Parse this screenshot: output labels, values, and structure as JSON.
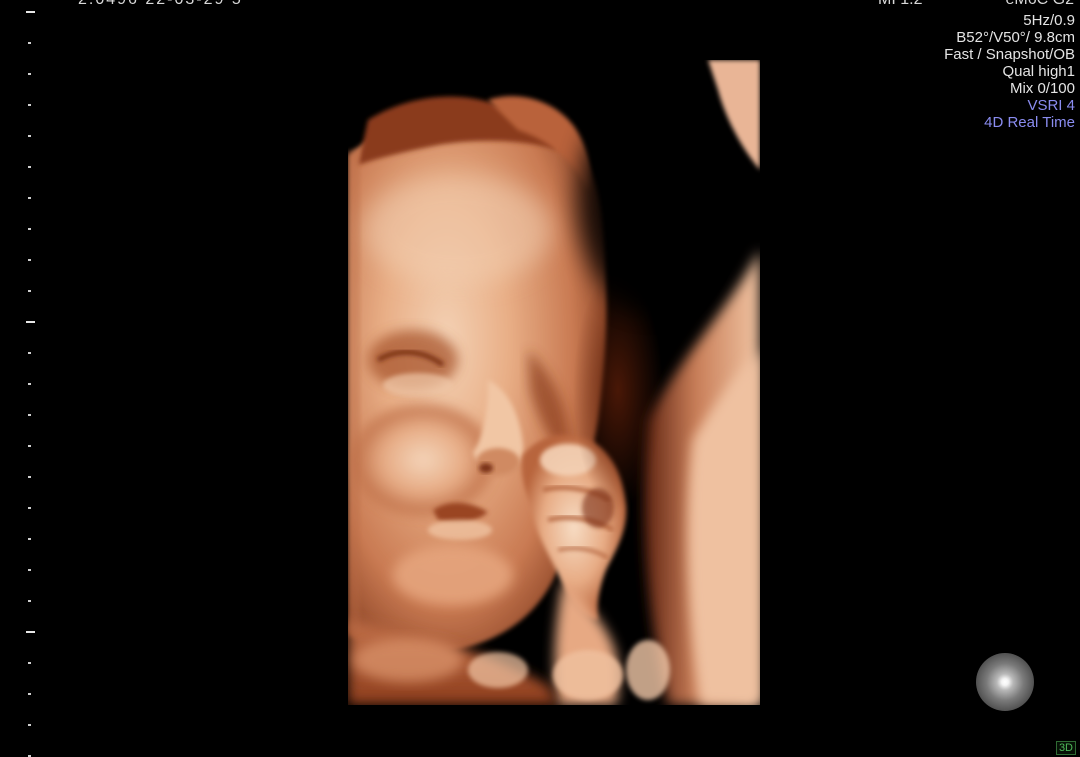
{
  "status_bar": {
    "datetime": "2:0496 22-03-29 5",
    "mi": "MI  1.2",
    "probe": "eM6C G2"
  },
  "parameters": [
    {
      "text": "5Hz/0.9",
      "accent": false
    },
    {
      "text": "B52°/V50°/ 9.8cm",
      "accent": false
    },
    {
      "text": "Fast / Snapshot/OB",
      "accent": false
    },
    {
      "text": "Qual high1",
      "accent": false
    },
    {
      "text": "Mix 0/100",
      "accent": false
    },
    {
      "text": "VSRI 4",
      "accent": true
    },
    {
      "text": "4D Real Time",
      "accent": true
    }
  ],
  "mode_label": "3D",
  "icons": {
    "orientation": "orientation-sphere-icon"
  },
  "colors": {
    "background": "#000000",
    "text": "#e4e4e4",
    "accent": "#8a8cf0",
    "render_tone": "#e0a27c"
  }
}
